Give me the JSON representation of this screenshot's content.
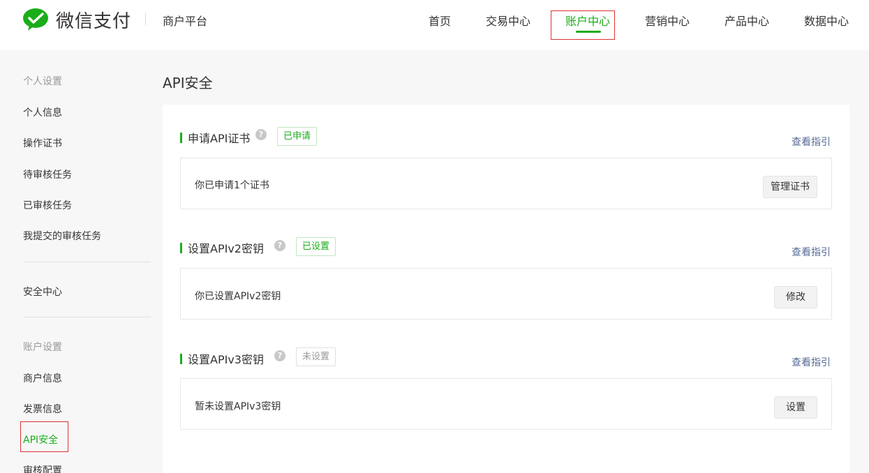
{
  "header": {
    "brand": "微信支付",
    "platform": "商户平台",
    "nav": [
      {
        "label": "首页"
      },
      {
        "label": "交易中心"
      },
      {
        "label": "账户中心",
        "active": true
      },
      {
        "label": "营销中心"
      },
      {
        "label": "产品中心"
      },
      {
        "label": "数据中心"
      }
    ]
  },
  "sidebar": {
    "group_personal": "个人设置",
    "personal_items": [
      "个人信息",
      "操作证书",
      "待审核任务",
      "已审核任务",
      "我提交的审核任务"
    ],
    "security_center": "安全中心",
    "group_account": "账户设置",
    "account_items": [
      "商户信息",
      "发票信息",
      "API安全",
      "审核配置"
    ],
    "active_item": "API安全"
  },
  "main": {
    "title": "API安全",
    "sections": [
      {
        "title": "申请API证书",
        "badge": "已申请",
        "badge_state": "ok",
        "guide": "查看指引",
        "description": "你已申请1个证书",
        "button": "管理证书"
      },
      {
        "title": "设置APIv2密钥",
        "badge": "已设置",
        "badge_state": "ok",
        "guide": "查看指引",
        "description": "你已设置APIv2密钥",
        "button": "修改"
      },
      {
        "title": "设置APIv3密钥",
        "badge": "未设置",
        "badge_state": "none",
        "guide": "查看指引",
        "description": "暂未设置APIv3密钥",
        "button": "设置"
      }
    ],
    "help_glyph": "?"
  },
  "colors": {
    "accent": "#1aad19",
    "link": "#576b95",
    "annotation": "#e03131"
  },
  "icons": {
    "logo": "wechat-pay-logo-icon",
    "help": "question-circle-icon"
  }
}
